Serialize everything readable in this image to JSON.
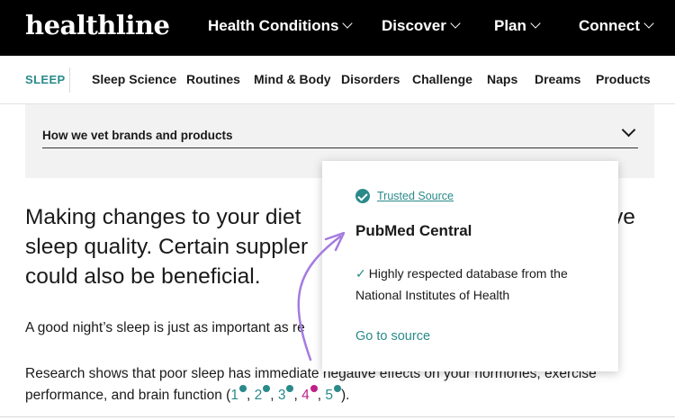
{
  "logo": "healthline",
  "top_nav": {
    "items": [
      {
        "label": "Health Conditions"
      },
      {
        "label": "Discover"
      },
      {
        "label": "Plan"
      },
      {
        "label": "Connect"
      }
    ]
  },
  "sub_nav": {
    "section": "SLEEP",
    "items": [
      {
        "label": "Sleep Science"
      },
      {
        "label": "Routines"
      },
      {
        "label": "Mind & Body"
      },
      {
        "label": "Disorders"
      },
      {
        "label": "Challenge"
      },
      {
        "label": "Naps"
      },
      {
        "label": "Dreams"
      },
      {
        "label": "Products"
      }
    ]
  },
  "accordion": {
    "label": "How we vet brands and products"
  },
  "article": {
    "intro": "Making changes to your diet is an important way to improve sleep quality. Certain supplements could also be beneficial.",
    "intro_visible": {
      "line1_left": "Making changes to your diet",
      "line1_right": "ve",
      "line2": "sleep quality. Certain suppler",
      "line3": "could also be beneficial."
    },
    "para1": "A good night’s sleep is just as important as re",
    "para2_text": "Research shows that poor sleep has immediate negative effects on your hormones, exercise performance, and brain function (",
    "para2_end": ").",
    "citations": [
      {
        "label": "1"
      },
      {
        "label": "2"
      },
      {
        "label": "3"
      },
      {
        "label": "4"
      },
      {
        "label": "5"
      }
    ]
  },
  "popup": {
    "badge": "Trusted Source",
    "title": "PubMed Central",
    "desc": "Highly respected database from the National Institutes of Health",
    "link": "Go to source"
  },
  "colors": {
    "accent": "#2a8a8a",
    "active_citation": "#c0208a",
    "arrow": "#a57be0"
  }
}
